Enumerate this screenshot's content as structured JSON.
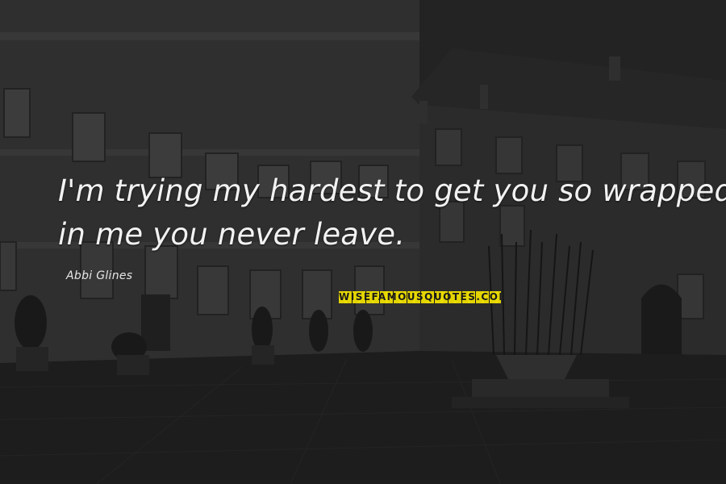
{
  "quote": {
    "line1": "I'm trying my hardest to get you so wrapped up",
    "line2": "in me you never leave."
  },
  "author": "Abbi Glines",
  "watermark": {
    "text": "WISEFAMOUSQUOTES.COM",
    "color": "#e4d500"
  },
  "palette": {
    "sky": "#2a2a2a",
    "building": "#3c3c3c",
    "ground": "#1b1b1b",
    "text": "#f2f2f2"
  }
}
